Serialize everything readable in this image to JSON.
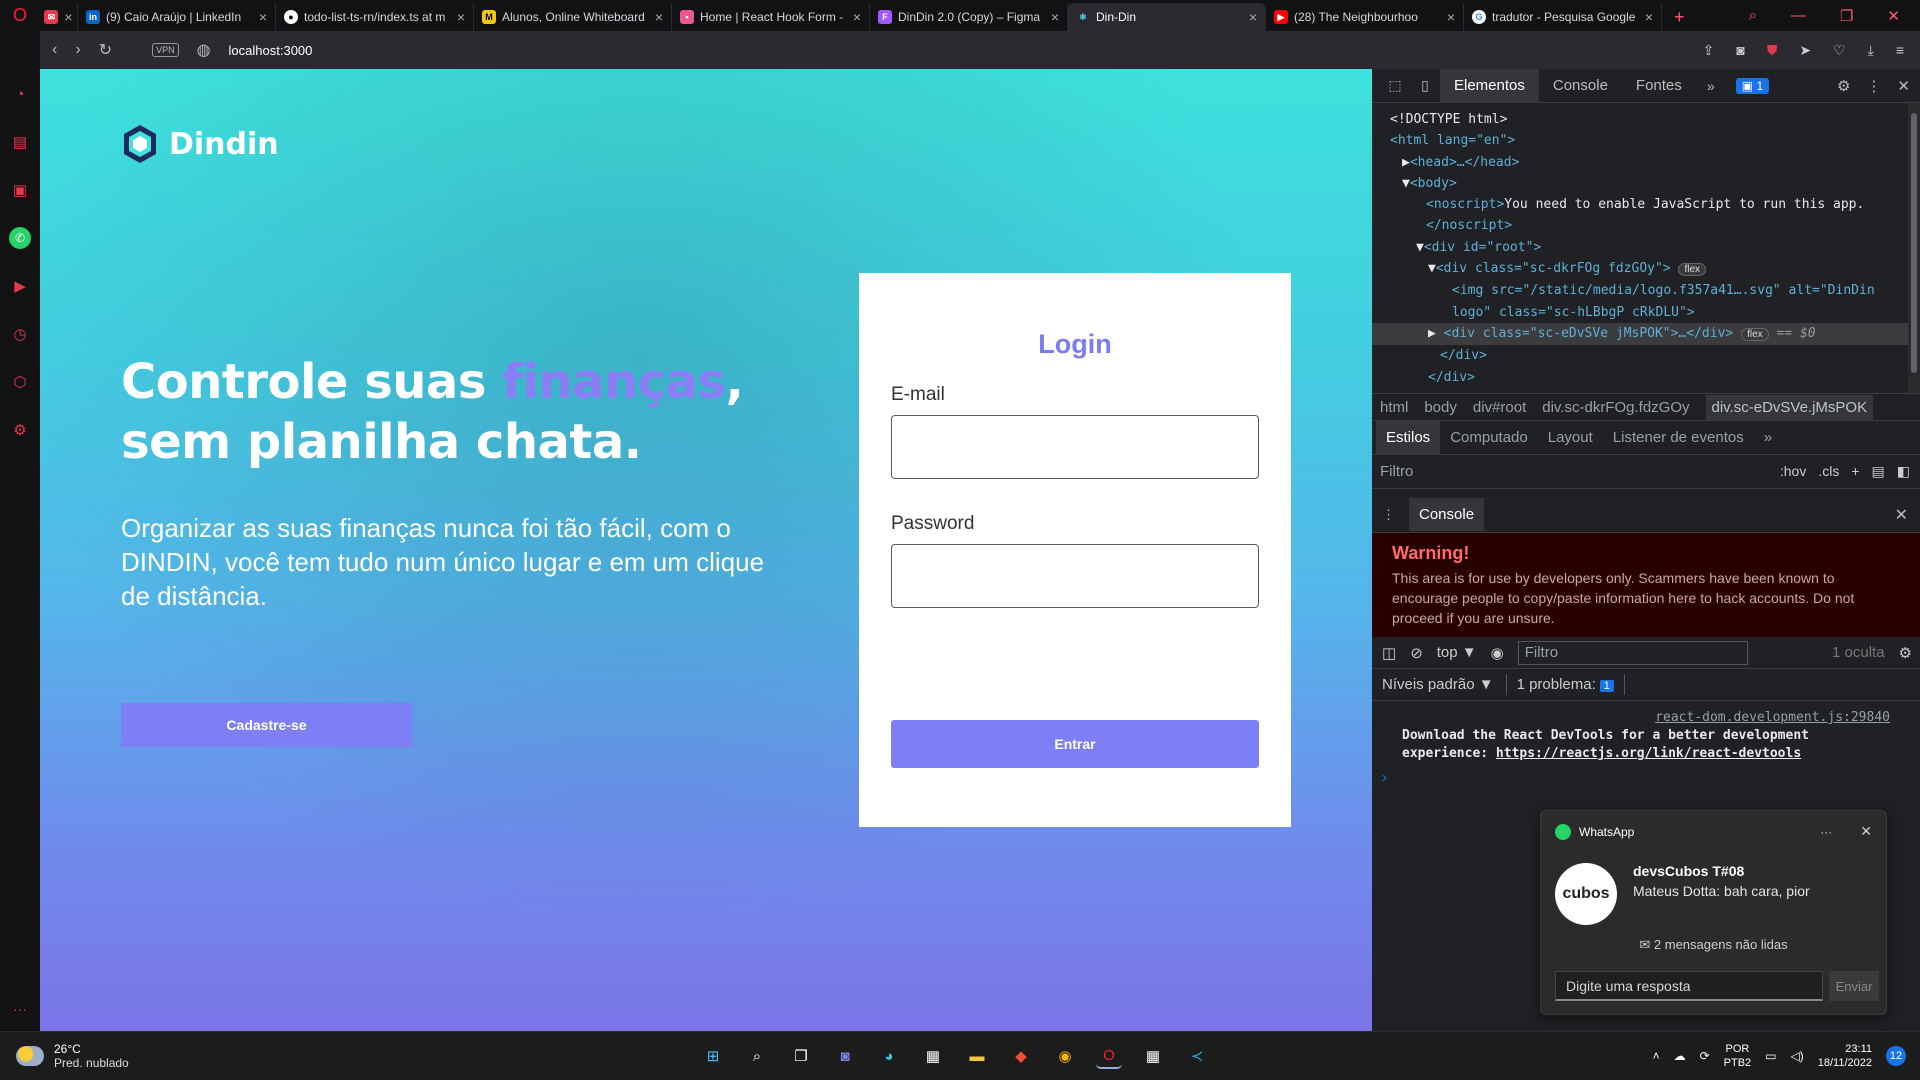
{
  "browser": {
    "tabs": [
      {
        "label": "",
        "icon": "mail-icon",
        "color": "#e53a4a"
      },
      {
        "label": "(9) Caio Araújo | LinkedIn",
        "icon": "linkedin-icon",
        "color": "#0a66c2"
      },
      {
        "label": "todo-list-ts-rn/index.ts at m",
        "icon": "github-icon",
        "color": "#ffffff"
      },
      {
        "label": "Alunos, Online Whiteboard",
        "icon": "whiteboard-icon",
        "color": "#f2c811"
      },
      {
        "label": "Home | React Hook Form -",
        "icon": "react-hook-form-icon",
        "color": "#ec5990"
      },
      {
        "label": "DinDin 2.0 (Copy) – Figma",
        "icon": "figma-icon",
        "color": "#a259ff"
      },
      {
        "label": "Din-Din",
        "icon": "react-icon",
        "color": "#61dafb",
        "active": true
      },
      {
        "label": "(28) The Neighbourhoo",
        "icon": "youtube-icon",
        "color": "#ff0000"
      },
      {
        "label": "tradutor - Pesquisa Google",
        "icon": "google-icon",
        "color": "#4285f4"
      }
    ],
    "new_tab": "+",
    "url": "localhost:3000",
    "vpn_label": "VPN"
  },
  "page": {
    "brand": "Dindin",
    "hero_title_part1": "Controle suas ",
    "hero_title_highlight": "finanças",
    "hero_title_part2": ",",
    "hero_title_line2": "sem planilha chata.",
    "hero_subtitle": "Organizar as suas finanças nunca foi tão fácil, com o DINDIN, você tem tudo num único lugar e em um clique de distância.",
    "signup_label": "Cadastre-se",
    "login": {
      "title": "Login",
      "email_label": "E-mail",
      "email_value": "",
      "password_label": "Password",
      "password_value": "",
      "submit_label": "Entrar"
    },
    "colors": {
      "primary": "#7f7ff5",
      "highlight": "#8b7df5"
    }
  },
  "devtools": {
    "tabs": [
      "Elementos",
      "Console",
      "Fontes"
    ],
    "issue_count": "1",
    "breadcrumb": [
      "html",
      "body",
      "div#root",
      "div.sc-dkrFOg.fdzGOy",
      "div.sc-eDvSVe.jMsPOK"
    ],
    "style_tabs": [
      "Estilos",
      "Computado",
      "Layout",
      "Listener de eventos"
    ],
    "filter_placeholder": "Filtro",
    "hov": ":hov",
    "cls": ".cls",
    "dom": {
      "doctype": "<!DOCTYPE html>",
      "html_open": "<html lang=\"en\">",
      "head": "<head>…</head>",
      "body_open": "<body>",
      "noscript_open": "<noscript>",
      "noscript_text": "You need to enable JavaScript to run this app.",
      "noscript_close": "</noscript>",
      "root_open": "<div id=\"root\">",
      "wrapper_open": "<div class=\"sc-dkrFOg fdzGOy\">",
      "flex_chip": "flex",
      "img_line1": "<img src=\"/static/media/logo.f357a41….svg\" alt=\"DinDin",
      "img_line2": "logo\" class=\"sc-hLBbgP cRkDLU\">",
      "selected_line": "<div class=\"sc-eDvSVe jMsPOK\">…</div>",
      "selected_suffix": "== $0",
      "div_close": "</div>",
      "div_close2": "</div>"
    },
    "console": {
      "tab": "Console",
      "warning_title": "Warning!",
      "warning_text": "This area is for use by developers only. Scammers have been known to encourage people to copy/paste information here to hack accounts. Do not proceed if you are unsure.",
      "context": "top ▼",
      "filter_placeholder": "Filtro",
      "hidden": "1 oculta",
      "levels": "Níveis padrão ▼",
      "issues": "1 problema:",
      "issues_count": "1",
      "msg_source": "react-dom.development.js:29840",
      "msg_text": "Download the React DevTools for a better development experience: ",
      "msg_link": "https://reactjs.org/link/react-devtools",
      "prompt": "›"
    }
  },
  "whatsapp": {
    "app": "WhatsApp",
    "more": "···",
    "avatar_text": "cubos",
    "group": "devsCubos T#08",
    "message": "Mateus Dotta: bah cara, pior",
    "unread": "✉ 2 mensagens não lidas",
    "reply_placeholder": "Digite uma resposta",
    "send": "Enviar"
  },
  "taskbar": {
    "temp": "26°C",
    "weather": "Pred. nublado",
    "lang1": "POR",
    "lang2": "PTB2",
    "time": "23:11",
    "date": "18/11/2022",
    "notifications": "12"
  }
}
